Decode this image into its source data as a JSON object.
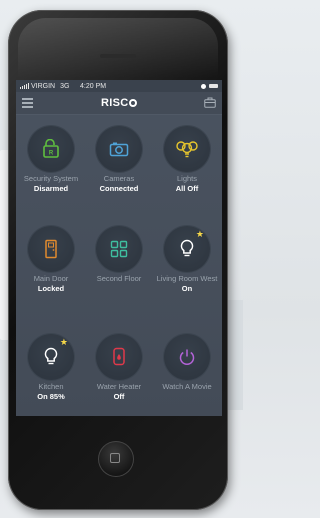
{
  "status_bar": {
    "carrier": "VIRGIN",
    "network": "3G",
    "time": "4:20 PM"
  },
  "app_bar": {
    "logo_text": "RISC"
  },
  "colors": {
    "accent_green": "#5fbf3f",
    "accent_blue": "#4fa3d8",
    "accent_yellow": "#e7c62d",
    "accent_orange": "#e08a2e",
    "accent_teal": "#3fbfa0",
    "accent_red": "#e0394a",
    "accent_purple": "#b463d8",
    "star": "#f6d84a"
  },
  "tiles": [
    {
      "label": "Security System",
      "status": "Disarmed",
      "icon": "shield-lock-icon"
    },
    {
      "label": "Cameras",
      "status": "Connected",
      "icon": "camera-icon"
    },
    {
      "label": "Lights",
      "status": "All Off",
      "icon": "bulbs-icon"
    },
    {
      "label": "Main Door",
      "status": "Locked",
      "icon": "door-icon"
    },
    {
      "label": "Second Floor",
      "status": "",
      "icon": "grid-icon"
    },
    {
      "label": "Living Room West",
      "status": "On",
      "icon": "bulb-star-icon"
    },
    {
      "label": "Kitchen",
      "status": "On 85%",
      "icon": "bulb-star-icon"
    },
    {
      "label": "Water Heater",
      "status": "Off",
      "icon": "water-heater-icon"
    },
    {
      "label": "Watch A Movie",
      "status": "",
      "icon": "power-icon"
    }
  ]
}
